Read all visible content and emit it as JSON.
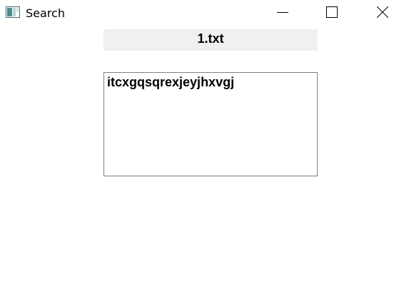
{
  "window": {
    "title": "Search",
    "icon": "app-window-icon"
  },
  "controls": {
    "minimize_icon": "minimize-icon",
    "maximize_icon": "maximize-icon",
    "close_icon": "close-icon"
  },
  "main": {
    "filename": "1.txt",
    "content": "itcxgqsqrexjeyjhxvgj"
  }
}
